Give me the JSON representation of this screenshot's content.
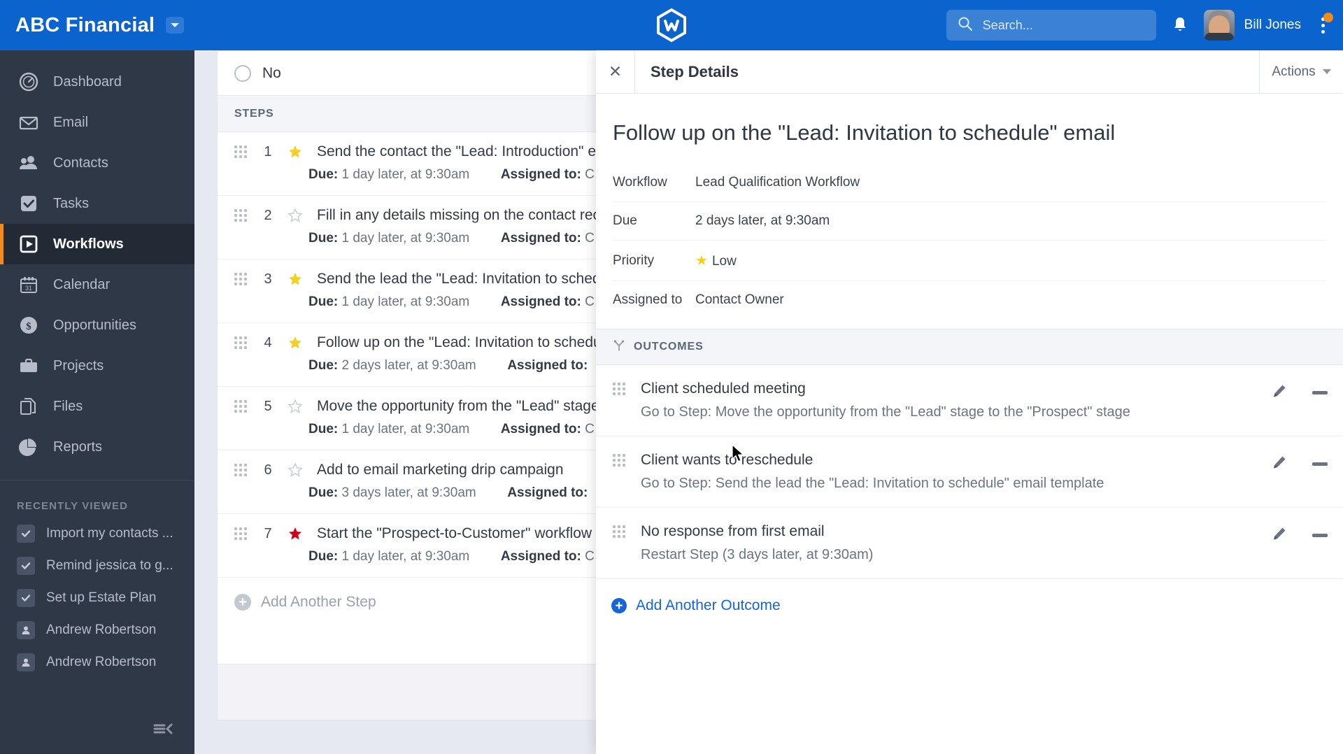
{
  "topbar": {
    "brand": "ABC Financial",
    "brand_caret_icon": "chevron-down-icon",
    "logo_icon": "hexagon-w-logo",
    "search": {
      "placeholder": "Search...",
      "value": "",
      "icon": "search-icon"
    },
    "notifications_icon": "bell-icon",
    "user_name": "Bill Jones",
    "avatar_icon": "user-avatar",
    "overflow_icon": "kebab-menu-icon",
    "accent_color": "#0b63ce",
    "badge_color": "#f08b1d"
  },
  "sidebar": {
    "items": [
      {
        "label": "Dashboard",
        "icon": "gauge-icon",
        "active": false
      },
      {
        "label": "Email",
        "icon": "envelope-icon",
        "active": false
      },
      {
        "label": "Contacts",
        "icon": "people-icon",
        "active": false
      },
      {
        "label": "Tasks",
        "icon": "check-square-icon",
        "active": false
      },
      {
        "label": "Workflows",
        "icon": "play-square-icon",
        "active": true
      },
      {
        "label": "Calendar",
        "icon": "calendar-31-icon",
        "active": false
      },
      {
        "label": "Opportunities",
        "icon": "dollar-coin-icon",
        "active": false
      },
      {
        "label": "Projects",
        "icon": "briefcase-icon",
        "active": false
      },
      {
        "label": "Files",
        "icon": "documents-icon",
        "active": false
      },
      {
        "label": "Reports",
        "icon": "pie-chart-icon",
        "active": false
      }
    ],
    "recently_viewed_title": "RECENTLY VIEWED",
    "recent": [
      {
        "label": "Import my contacts ...",
        "icon": "check-icon"
      },
      {
        "label": "Remind jessica to g...",
        "icon": "check-icon"
      },
      {
        "label": "Set up Estate Plan",
        "icon": "check-icon"
      },
      {
        "label": "Andrew Robertson",
        "icon": "person-icon"
      },
      {
        "label": "Andrew Robertson",
        "icon": "person-icon"
      }
    ],
    "collapse_icon": "collapse-sidebar-icon",
    "active_marker_color": "#f08b1d"
  },
  "steps_panel": {
    "question_option": "No",
    "section_header": "STEPS",
    "due_label": "Due:",
    "assigned_label": "Assigned to:",
    "assigned_value": "C",
    "add_step_label": "Add Another Step",
    "steps": [
      {
        "num": "1",
        "star": "filled-yellow",
        "title": "Send the contact the \"Lead: Introduction\" ema",
        "due": "1 day later, at 9:30am"
      },
      {
        "num": "2",
        "star": "empty",
        "title": "Fill in any details missing on the contact recor",
        "due": "1 day later, at 9:30am"
      },
      {
        "num": "3",
        "star": "filled-yellow",
        "title": "Send the lead the \"Lead: Invitation to schedul",
        "due": "1 day later, at 9:30am"
      },
      {
        "num": "4",
        "star": "filled-yellow",
        "title": "Follow up on the \"Lead: Invitation to schedule\"",
        "due": "2 days later, at 9:30am"
      },
      {
        "num": "5",
        "star": "empty",
        "title": "Move the opportunity from the \"Lead\" stage t",
        "due": "1 day later, at 9:30am"
      },
      {
        "num": "6",
        "star": "empty",
        "title": "Add to email marketing drip campaign",
        "due": "3 days later, at 9:30am"
      },
      {
        "num": "7",
        "star": "filled-red",
        "title": "Start the \"Prospect-to-Customer\" workflow",
        "due": "1 day later, at 9:30am"
      }
    ]
  },
  "step_details": {
    "close_icon": "close-icon",
    "header_title": "Step Details",
    "actions_label": "Actions",
    "actions_caret_icon": "chevron-down-icon",
    "title": "Follow up on the \"Lead: Invitation to schedule\" email",
    "fields": [
      {
        "key": "Workflow",
        "value": "Lead Qualification Workflow",
        "star": false
      },
      {
        "key": "Due",
        "value": "2 days later, at 9:30am",
        "star": false
      },
      {
        "key": "Priority",
        "value": "Low",
        "star": true
      },
      {
        "key": "Assigned to",
        "value": "Contact Owner",
        "star": false
      }
    ],
    "outcomes_header": "OUTCOMES",
    "outcomes_icon": "branch-icon",
    "outcomes": [
      {
        "title": "Client scheduled meeting",
        "sub": "Go to Step: Move the opportunity from the \"Lead\" stage to the \"Prospect\" stage",
        "edit_icon": "pencil-icon",
        "remove_icon": "minus-icon"
      },
      {
        "title": "Client wants to reschedule",
        "sub": "Go to Step: Send the lead the \"Lead: Invitation to schedule\" email template",
        "edit_icon": "pencil-icon",
        "remove_icon": "minus-icon"
      },
      {
        "title": "No response from first email",
        "sub": "Restart Step (3 days later, at 9:30am)",
        "edit_icon": "pencil-icon",
        "remove_icon": "minus-icon"
      }
    ],
    "add_outcome_label": "Add Another Outcome",
    "link_color": "#1565d8"
  }
}
